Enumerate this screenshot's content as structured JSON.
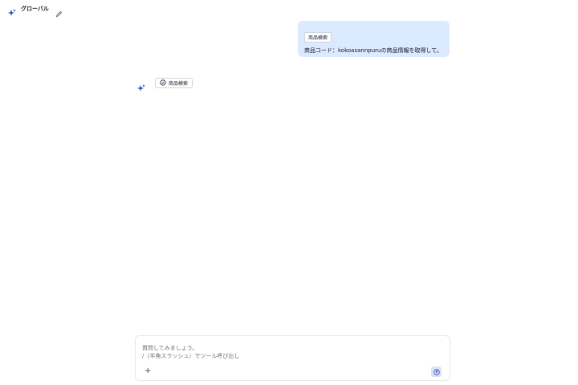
{
  "header": {
    "title": "グローバル",
    "sparkle_icon": "sparkle-icon",
    "edit_icon": "pencil-icon"
  },
  "conversation": {
    "user_message": {
      "tool_chip_label": "商品検索",
      "text": "商品コード：kokoasannpuruの商品情報を取得して。"
    },
    "assistant": {
      "icon": "sparkle-icon",
      "tool_status_label": "商品検索",
      "tool_status_icon": "check-circle-icon"
    }
  },
  "composer": {
    "placeholder": "質問してみましょう。\n/（半角スラッシュ）でツール呼び出し",
    "add_label": "+",
    "send_icon": "send-icon"
  },
  "colors": {
    "user_bubble": "#dbeafe",
    "accent": "#3b5bdb",
    "send_button": "#dbe3f0"
  }
}
